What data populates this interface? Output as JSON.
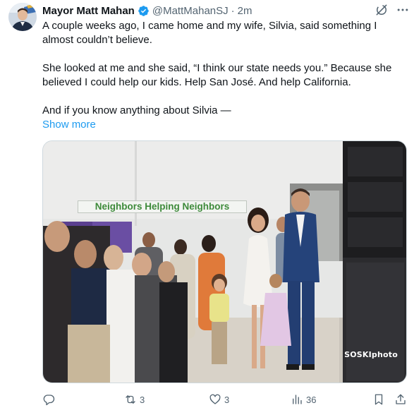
{
  "tweet": {
    "author_name": "Mayor Matt Mahan",
    "handle": "@MattMahanSJ",
    "separator": "·",
    "timestamp": "2m",
    "body": [
      "A couple weeks ago, I came home and my wife, Silvia, said something I almost couldn’t believe.",
      "She looked at me and she said, “I think our state needs you.” Because she believed I could help our kids. Help San José. And help California.",
      "And if you know anything about Silvia —"
    ],
    "show_more": "Show more"
  },
  "photo": {
    "wall_sign": "Neighbors Helping Neighbors",
    "watermark": "SOSKIphoto"
  },
  "actions": {
    "reply_count": "",
    "repost_count": "3",
    "like_count": "3",
    "views_count": "36"
  },
  "icons": {
    "verified": "verified-badge-icon",
    "grok": "grok-icon",
    "more": "more-icon",
    "reply": "reply-icon",
    "repost": "repost-icon",
    "like": "like-icon",
    "views": "views-icon",
    "bookmark": "bookmark-icon",
    "share": "share-icon"
  },
  "colors": {
    "accent": "#1d9bf0",
    "text_primary": "#0f1419",
    "text_secondary": "#536471"
  }
}
